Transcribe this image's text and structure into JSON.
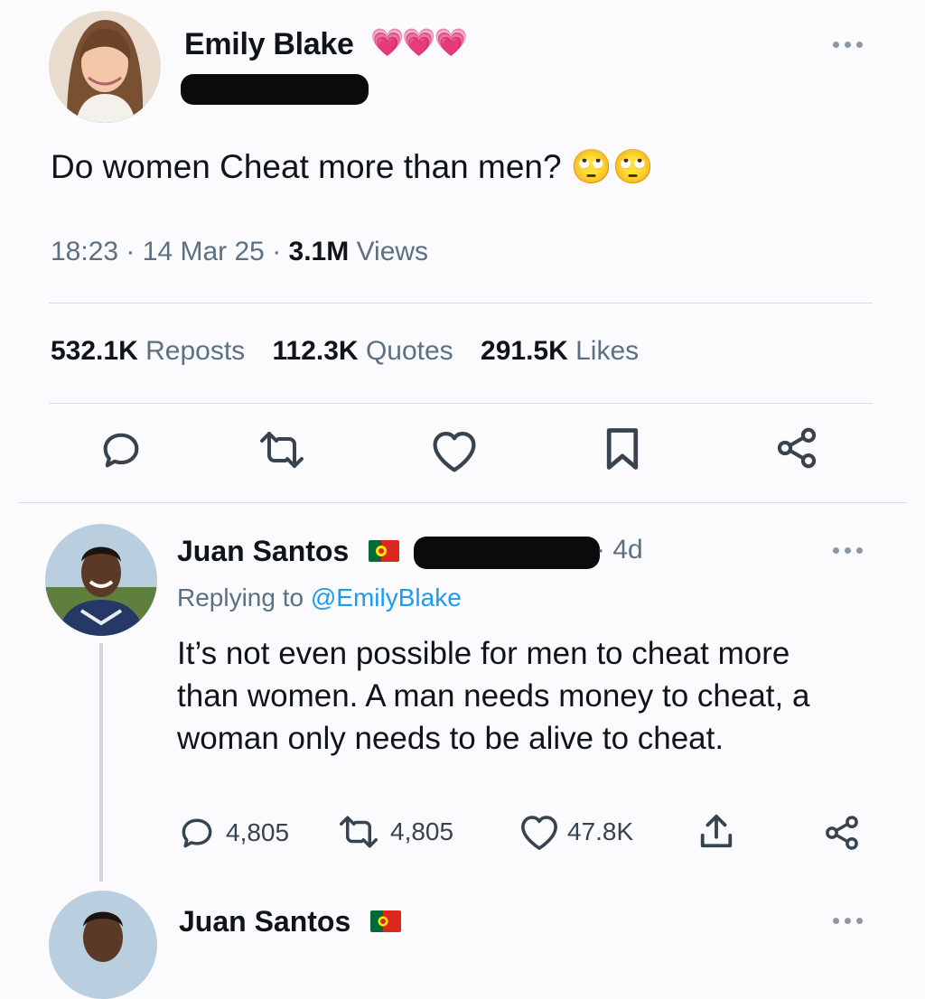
{
  "tweet": {
    "author_name": "Emily Blake",
    "author_hearts": "💗💗💗",
    "text": "Do women Cheat more than men?",
    "emoji": "🙄🙄",
    "time": "18:23",
    "date": "14 Mar 25",
    "views_count": "3.1M",
    "views_label": "Views",
    "sep": "·",
    "reposts_count": "532.1K",
    "reposts_label": "Reposts",
    "quotes_count": "112.3K",
    "quotes_label": "Quotes",
    "likes_count": "291.5K",
    "likes_label": "Likes"
  },
  "reply": {
    "author_name": "Juan Santos",
    "age": "· 4d",
    "replying_prefix": "Replying to",
    "replying_handle": "@EmilyBlake",
    "text": "It’s not even possible for men to cheat more than women. A man needs money to cheat, a woman only needs to be alive to cheat.",
    "reply_count": "4,805",
    "repost_count": "4,805",
    "like_count": "47.8K"
  },
  "next_reply": {
    "author_name": "Juan Santos"
  },
  "colors": {
    "text": "#0f1419",
    "muted": "#5b7083",
    "link": "#1d9bf0",
    "divider": "#d9dde1",
    "heart_pink": "#e8409a"
  },
  "icons": [
    "reply-icon",
    "repost-icon",
    "like-icon",
    "bookmark-icon",
    "share-icon",
    "more-icon",
    "upload-icon",
    "flag-portugal-icon"
  ]
}
